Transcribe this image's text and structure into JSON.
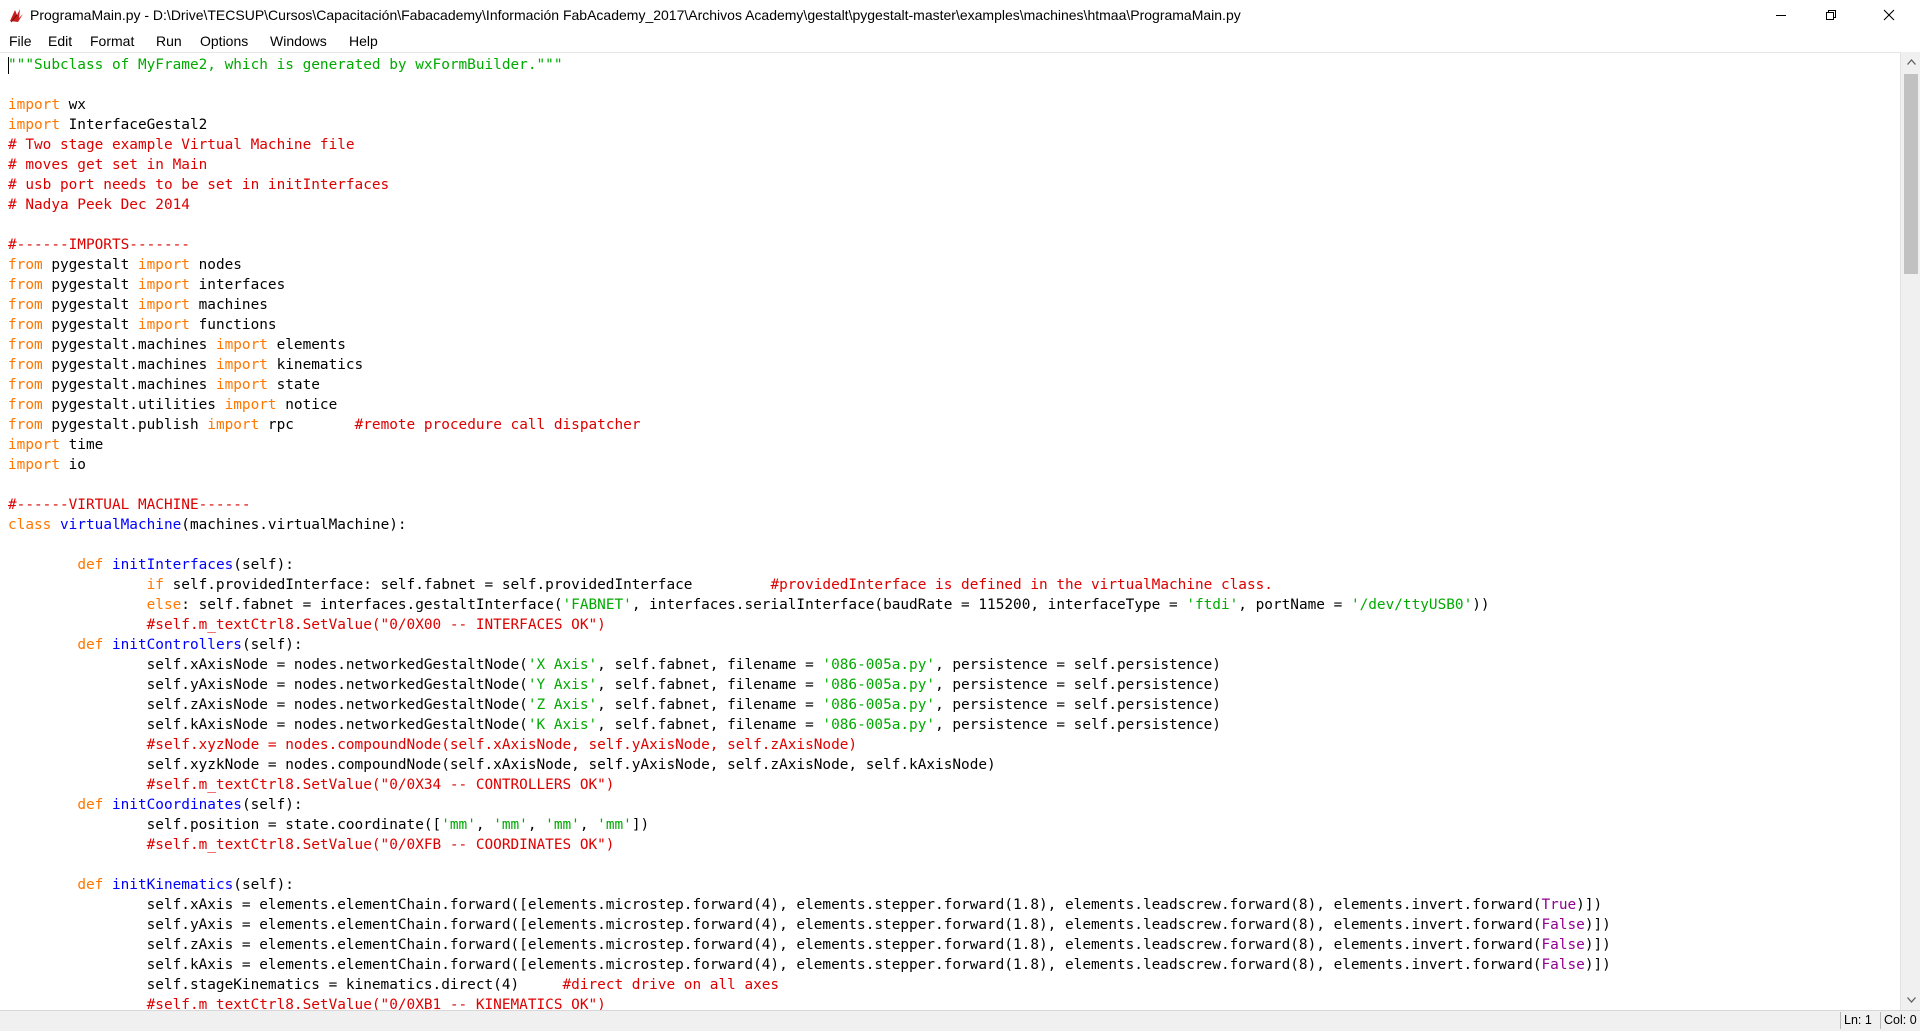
{
  "window": {
    "title": "ProgramaMain.py - D:\\Drive\\TECSUP\\Cursos\\Capacitación\\Fabacademy\\Información FabAcademy_2017\\Archivos Academy\\gestalt\\pygestalt-master\\examples\\machines\\htmaa\\ProgramaMain.py",
    "app_icon": "tk-feather-icon",
    "controls": [
      "minimize-icon",
      "restore-icon",
      "close-icon"
    ]
  },
  "menu": [
    "File",
    "Edit",
    "Format",
    "Run",
    "Options",
    "Windows",
    "Help"
  ],
  "colors": {
    "keyword": "#ff7700",
    "string": "#00aa00",
    "comment": "#dd0000",
    "definition": "#0000ff",
    "builtin": "#900090",
    "text": "#000000"
  },
  "code": [
    [
      [
        "s",
        "\"\"\"Subclass of MyFrame2, which is generated by wxFormBuilder.\"\"\""
      ]
    ],
    [],
    [
      [
        "k",
        "import"
      ],
      [
        "p",
        " wx"
      ]
    ],
    [
      [
        "k",
        "import"
      ],
      [
        "p",
        " InterfaceGestal2"
      ]
    ],
    [
      [
        "c",
        "# Two stage example Virtual Machine file"
      ]
    ],
    [
      [
        "c",
        "# moves get set in Main"
      ]
    ],
    [
      [
        "c",
        "# usb port needs to be set in initInterfaces"
      ]
    ],
    [
      [
        "c",
        "# Nadya Peek Dec 2014"
      ]
    ],
    [],
    [
      [
        "c",
        "#------IMPORTS-------"
      ]
    ],
    [
      [
        "k",
        "from"
      ],
      [
        "p",
        " pygestalt "
      ],
      [
        "k",
        "import"
      ],
      [
        "p",
        " nodes"
      ]
    ],
    [
      [
        "k",
        "from"
      ],
      [
        "p",
        " pygestalt "
      ],
      [
        "k",
        "import"
      ],
      [
        "p",
        " interfaces"
      ]
    ],
    [
      [
        "k",
        "from"
      ],
      [
        "p",
        " pygestalt "
      ],
      [
        "k",
        "import"
      ],
      [
        "p",
        " machines"
      ]
    ],
    [
      [
        "k",
        "from"
      ],
      [
        "p",
        " pygestalt "
      ],
      [
        "k",
        "import"
      ],
      [
        "p",
        " functions"
      ]
    ],
    [
      [
        "k",
        "from"
      ],
      [
        "p",
        " pygestalt.machines "
      ],
      [
        "k",
        "import"
      ],
      [
        "p",
        " elements"
      ]
    ],
    [
      [
        "k",
        "from"
      ],
      [
        "p",
        " pygestalt.machines "
      ],
      [
        "k",
        "import"
      ],
      [
        "p",
        " kinematics"
      ]
    ],
    [
      [
        "k",
        "from"
      ],
      [
        "p",
        " pygestalt.machines "
      ],
      [
        "k",
        "import"
      ],
      [
        "p",
        " state"
      ]
    ],
    [
      [
        "k",
        "from"
      ],
      [
        "p",
        " pygestalt.utilities "
      ],
      [
        "k",
        "import"
      ],
      [
        "p",
        " notice"
      ]
    ],
    [
      [
        "k",
        "from"
      ],
      [
        "p",
        " pygestalt.publish "
      ],
      [
        "k",
        "import"
      ],
      [
        "p",
        " rpc       "
      ],
      [
        "c",
        "#remote procedure call dispatcher"
      ]
    ],
    [
      [
        "k",
        "import"
      ],
      [
        "p",
        " time"
      ]
    ],
    [
      [
        "k",
        "import"
      ],
      [
        "p",
        " io"
      ]
    ],
    [],
    [
      [
        "c",
        "#------VIRTUAL MACHINE------"
      ]
    ],
    [
      [
        "k",
        "class"
      ],
      [
        "p",
        " "
      ],
      [
        "d",
        "virtualMachine"
      ],
      [
        "p",
        "(machines.virtualMachine):"
      ]
    ],
    [],
    [
      [
        "p",
        "        "
      ],
      [
        "k",
        "def"
      ],
      [
        "p",
        " "
      ],
      [
        "d",
        "initInterfaces"
      ],
      [
        "p",
        "(self):"
      ]
    ],
    [
      [
        "p",
        "                "
      ],
      [
        "k",
        "if"
      ],
      [
        "p",
        " self.providedInterface: self.fabnet = self.providedInterface         "
      ],
      [
        "c",
        "#providedInterface is defined in the virtualMachine class."
      ]
    ],
    [
      [
        "p",
        "                "
      ],
      [
        "k",
        "else"
      ],
      [
        "p",
        ": self.fabnet = interfaces.gestaltInterface("
      ],
      [
        "s",
        "'FABNET'"
      ],
      [
        "p",
        ", interfaces.serialInterface(baudRate = 115200, interfaceType = "
      ],
      [
        "s",
        "'ftdi'"
      ],
      [
        "p",
        ", portName = "
      ],
      [
        "s",
        "'/dev/ttyUSB0'"
      ],
      [
        "p",
        "))"
      ]
    ],
    [
      [
        "p",
        "                "
      ],
      [
        "c",
        "#self.m_textCtrl8.SetValue(\"0/0X00 -- INTERFACES OK\")"
      ]
    ],
    [
      [
        "p",
        "        "
      ],
      [
        "k",
        "def"
      ],
      [
        "p",
        " "
      ],
      [
        "d",
        "initControllers"
      ],
      [
        "p",
        "(self):"
      ]
    ],
    [
      [
        "p",
        "                self.xAxisNode = nodes.networkedGestaltNode("
      ],
      [
        "s",
        "'X Axis'"
      ],
      [
        "p",
        ", self.fabnet, filename = "
      ],
      [
        "s",
        "'086-005a.py'"
      ],
      [
        "p",
        ", persistence = self.persistence)"
      ]
    ],
    [
      [
        "p",
        "                self.yAxisNode = nodes.networkedGestaltNode("
      ],
      [
        "s",
        "'Y Axis'"
      ],
      [
        "p",
        ", self.fabnet, filename = "
      ],
      [
        "s",
        "'086-005a.py'"
      ],
      [
        "p",
        ", persistence = self.persistence)"
      ]
    ],
    [
      [
        "p",
        "                self.zAxisNode = nodes.networkedGestaltNode("
      ],
      [
        "s",
        "'Z Axis'"
      ],
      [
        "p",
        ", self.fabnet, filename = "
      ],
      [
        "s",
        "'086-005a.py'"
      ],
      [
        "p",
        ", persistence = self.persistence)"
      ]
    ],
    [
      [
        "p",
        "                self.kAxisNode = nodes.networkedGestaltNode("
      ],
      [
        "s",
        "'K Axis'"
      ],
      [
        "p",
        ", self.fabnet, filename = "
      ],
      [
        "s",
        "'086-005a.py'"
      ],
      [
        "p",
        ", persistence = self.persistence)"
      ]
    ],
    [
      [
        "p",
        "                "
      ],
      [
        "c",
        "#self.xyzNode = nodes.compoundNode(self.xAxisNode, self.yAxisNode, self.zAxisNode)"
      ]
    ],
    [
      [
        "p",
        "                self.xyzkNode = nodes.compoundNode(self.xAxisNode, self.yAxisNode, self.zAxisNode, self.kAxisNode)"
      ]
    ],
    [
      [
        "p",
        "                "
      ],
      [
        "c",
        "#self.m_textCtrl8.SetValue(\"0/0X34 -- CONTROLLERS OK\")"
      ]
    ],
    [
      [
        "p",
        "        "
      ],
      [
        "k",
        "def"
      ],
      [
        "p",
        " "
      ],
      [
        "d",
        "initCoordinates"
      ],
      [
        "p",
        "(self):"
      ]
    ],
    [
      [
        "p",
        "                self.position = state.coordinate(["
      ],
      [
        "s",
        "'mm'"
      ],
      [
        "p",
        ", "
      ],
      [
        "s",
        "'mm'"
      ],
      [
        "p",
        ", "
      ],
      [
        "s",
        "'mm'"
      ],
      [
        "p",
        ", "
      ],
      [
        "s",
        "'mm'"
      ],
      [
        "p",
        "])"
      ]
    ],
    [
      [
        "p",
        "                "
      ],
      [
        "c",
        "#self.m_textCtrl8.SetValue(\"0/0XFB -- COORDINATES OK\")"
      ]
    ],
    [],
    [
      [
        "p",
        "        "
      ],
      [
        "k",
        "def"
      ],
      [
        "p",
        " "
      ],
      [
        "d",
        "initKinematics"
      ],
      [
        "p",
        "(self):"
      ]
    ],
    [
      [
        "p",
        "                self.xAxis = elements.elementChain.forward([elements.microstep.forward(4), elements.stepper.forward(1.8), elements.leadscrew.forward(8), elements.invert.forward("
      ],
      [
        "b",
        "True"
      ],
      [
        "p",
        ")])"
      ]
    ],
    [
      [
        "p",
        "                self.yAxis = elements.elementChain.forward([elements.microstep.forward(4), elements.stepper.forward(1.8), elements.leadscrew.forward(8), elements.invert.forward("
      ],
      [
        "b",
        "False"
      ],
      [
        "p",
        ")])"
      ]
    ],
    [
      [
        "p",
        "                self.zAxis = elements.elementChain.forward([elements.microstep.forward(4), elements.stepper.forward(1.8), elements.leadscrew.forward(8), elements.invert.forward("
      ],
      [
        "b",
        "False"
      ],
      [
        "p",
        ")])"
      ]
    ],
    [
      [
        "p",
        "                self.kAxis = elements.elementChain.forward([elements.microstep.forward(4), elements.stepper.forward(1.8), elements.leadscrew.forward(8), elements.invert.forward("
      ],
      [
        "b",
        "False"
      ],
      [
        "p",
        ")])"
      ]
    ],
    [
      [
        "p",
        "                self.stageKinematics = kinematics.direct(4)     "
      ],
      [
        "c",
        "#direct drive on all axes"
      ]
    ],
    [
      [
        "p",
        "                "
      ],
      [
        "c",
        "#self.m_textCtrl8.SetValue(\"0/0XB1 -- KINEMATICS OK\")"
      ]
    ]
  ],
  "status": {
    "line": "Ln: 1",
    "col": "Col: 0"
  }
}
